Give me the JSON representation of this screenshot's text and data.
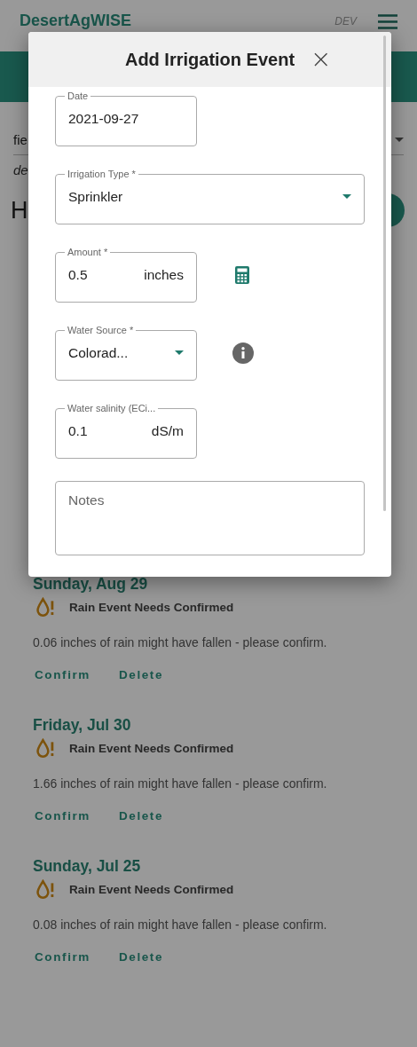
{
  "app": {
    "title": "DesertAgWISE",
    "environment": "DEV"
  },
  "background": {
    "field_select": "fie",
    "subtitle": "de",
    "heading": "H"
  },
  "dialog": {
    "title": "Add Irrigation Event",
    "close": "×",
    "fields": [
      {
        "kind": "text",
        "label": "Date",
        "value": "2021-09-27",
        "wide": false
      },
      {
        "kind": "select",
        "label": "Irrigation Type *",
        "value": "Sprinkler",
        "wide": true
      },
      {
        "kind": "unit",
        "label": "Amount *",
        "value": "0.5",
        "unit": "inches",
        "wide": false,
        "accessory": {
          "kind": "calculator"
        }
      },
      {
        "kind": "select",
        "label": "Water Source *",
        "value": "Colorad...",
        "wide": false,
        "accessory": {
          "kind": "info"
        }
      },
      {
        "kind": "unit",
        "label": "Water salinity (ECi...",
        "value": "0.1",
        "unit": "dS/m",
        "wide": false
      },
      {
        "kind": "textarea",
        "placeholder": "Notes",
        "wide": true
      }
    ]
  },
  "events": [
    {
      "date": "Sunday, Aug 29",
      "status": "Rain Event Needs Confirmed",
      "message": "0.06 inches of rain might have fallen - please confirm.",
      "actions": [
        "Confirm",
        "Delete"
      ]
    },
    {
      "date": "Friday, Jul 30",
      "status": "Rain Event Needs Confirmed",
      "message": "1.66 inches of rain might have fallen - please confirm.",
      "actions": [
        "Confirm",
        "Delete"
      ]
    },
    {
      "date": "Sunday, Jul 25",
      "status": "Rain Event Needs Confirmed",
      "message": "0.08 inches of rain might have fallen - please confirm.",
      "actions": [
        "Confirm",
        "Delete"
      ]
    }
  ]
}
